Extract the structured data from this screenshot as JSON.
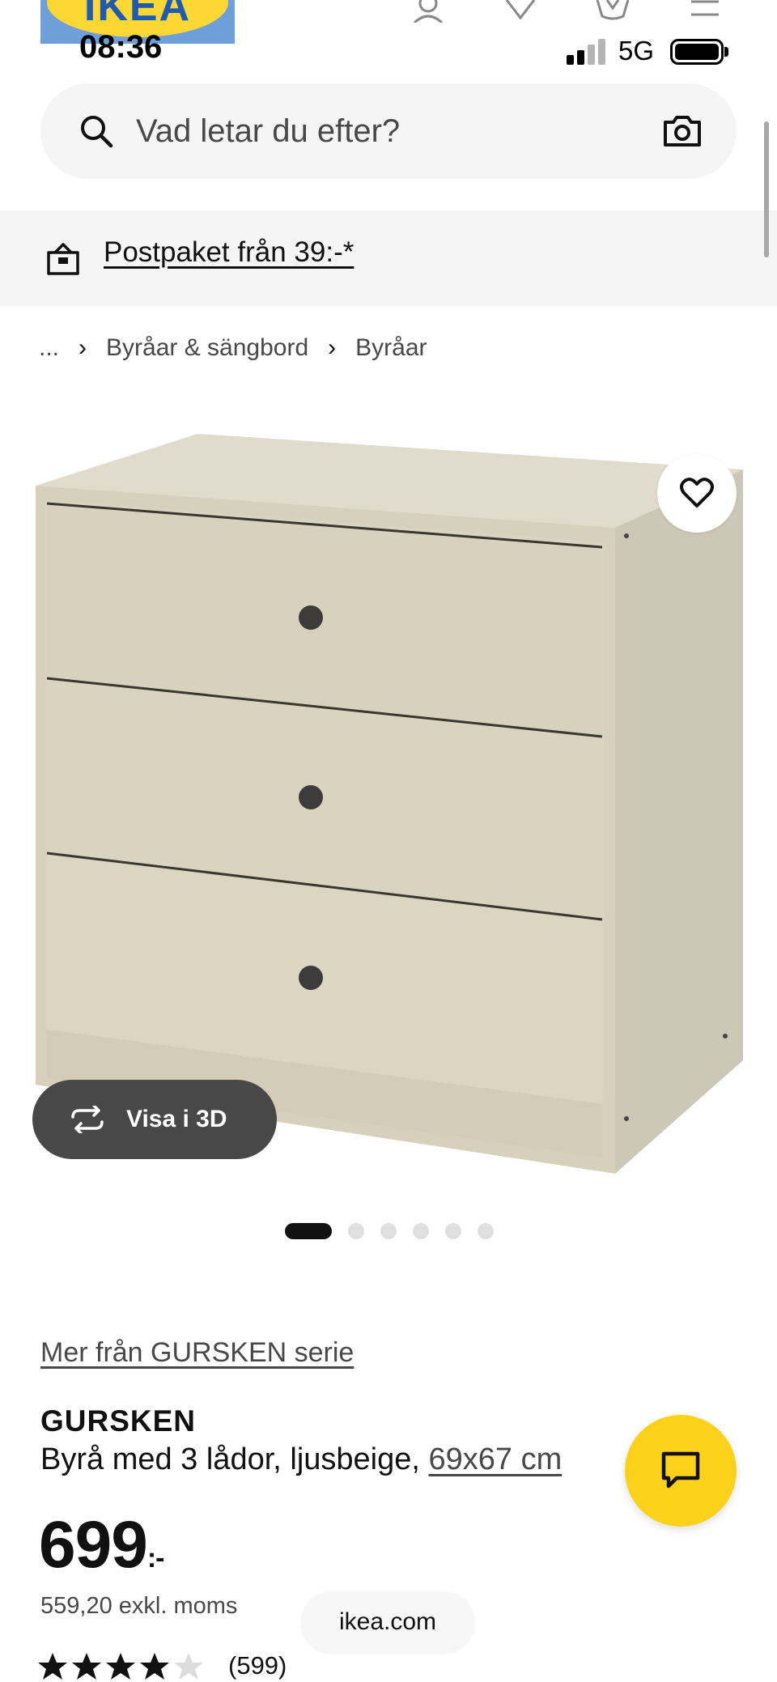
{
  "brand": {
    "logo_text": "IKEA"
  },
  "status_bar": {
    "time": "08:36",
    "network": "5G"
  },
  "search": {
    "placeholder": "Vad letar du efter?"
  },
  "banner": {
    "text": "Postpaket från 39:-*"
  },
  "breadcrumb": {
    "items": [
      "...",
      "Byråar & sängbord",
      "Byråar"
    ]
  },
  "product_image": {
    "view_3d_label": "Visa i 3D",
    "carousel": {
      "count": 6,
      "active_index": 0
    }
  },
  "product": {
    "series_link": "Mer från GURSKEN serie",
    "name": "GURSKEN",
    "description": "Byrå med 3 lådor, ljusbeige, ",
    "dimensions": "69x67 cm",
    "price_main": "699",
    "price_suffix": ":-",
    "price_excl": "559,20 exkl. moms",
    "rating_stars": 4,
    "rating_count": "(599)"
  },
  "browser": {
    "url_label": "ikea.com"
  },
  "colors": {
    "accent_yellow": "#fcd11a",
    "dark_gray": "#484848",
    "light_bg": "#f5f5f5"
  }
}
